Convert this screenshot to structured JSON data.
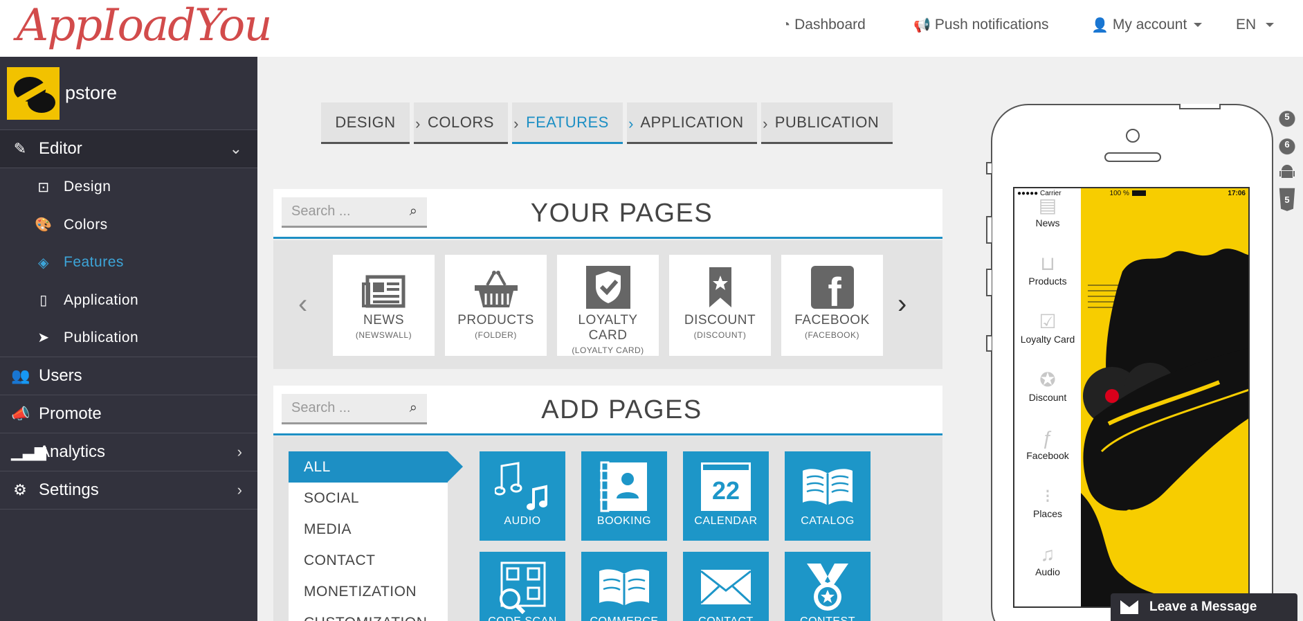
{
  "app": {
    "logo_text": "AppIoadYou"
  },
  "topnav": {
    "dashboard": "Dashboard",
    "push": "Push notifications",
    "account": "My account",
    "language": "EN"
  },
  "sidebar": {
    "brand": "pstore",
    "editor": "Editor",
    "sub_items": [
      {
        "label": "Design",
        "icon": "design-icon"
      },
      {
        "label": "Colors",
        "icon": "palette-icon"
      },
      {
        "label": "Features",
        "icon": "cube-icon"
      },
      {
        "label": "Application",
        "icon": "mobile-icon"
      },
      {
        "label": "Publication",
        "icon": "paper-plane-icon"
      }
    ],
    "users": "Users",
    "promote": "Promote",
    "analytics": "Analytics",
    "settings": "Settings"
  },
  "steps": [
    "DESIGN",
    "COLORS",
    "FEATURES",
    "APPLICATION",
    "PUBLICATION"
  ],
  "your_pages": {
    "title": "YOUR PAGES",
    "search_placeholder": "Search ...",
    "cards": [
      {
        "name": "NEWS",
        "type": "(NEWSWALL)"
      },
      {
        "name": "PRODUCTS",
        "type": "(FOLDER)"
      },
      {
        "name": "LOYALTY CARD",
        "type": "(LOYALTY CARD)"
      },
      {
        "name": "DISCOUNT",
        "type": "(DISCOUNT)"
      },
      {
        "name": "FACEBOOK",
        "type": "(FACEBOOK)"
      }
    ]
  },
  "add_pages": {
    "title": "ADD PAGES",
    "search_placeholder": "Search ...",
    "categories": [
      "ALL",
      "SOCIAL",
      "MEDIA",
      "CONTACT",
      "MONETIZATION",
      "CUSTOMIZATION"
    ],
    "tiles": [
      {
        "label": "AUDIO"
      },
      {
        "label": "BOOKING"
      },
      {
        "label": "CALENDAR",
        "number": "22"
      },
      {
        "label": "CATALOG"
      },
      {
        "label": "CODE SCAN"
      },
      {
        "label": "COMMERCE"
      },
      {
        "label": "CONTACT"
      },
      {
        "label": "CONTEST"
      }
    ]
  },
  "phone": {
    "carrier": "Carrier",
    "battery": "100 %",
    "time": "17:06",
    "menu": [
      "News",
      "Products",
      "Loyalty Card",
      "Discount",
      "Facebook",
      "Places",
      "Audio"
    ]
  },
  "os_icons": [
    {
      "icon": "apple-icon",
      "label": "5"
    },
    {
      "icon": "apple-icon",
      "label": "6"
    },
    {
      "icon": "android-icon",
      "label": ""
    },
    {
      "icon": "html5-icon",
      "label": "5"
    }
  ],
  "chat": {
    "label": "Leave a Message"
  }
}
